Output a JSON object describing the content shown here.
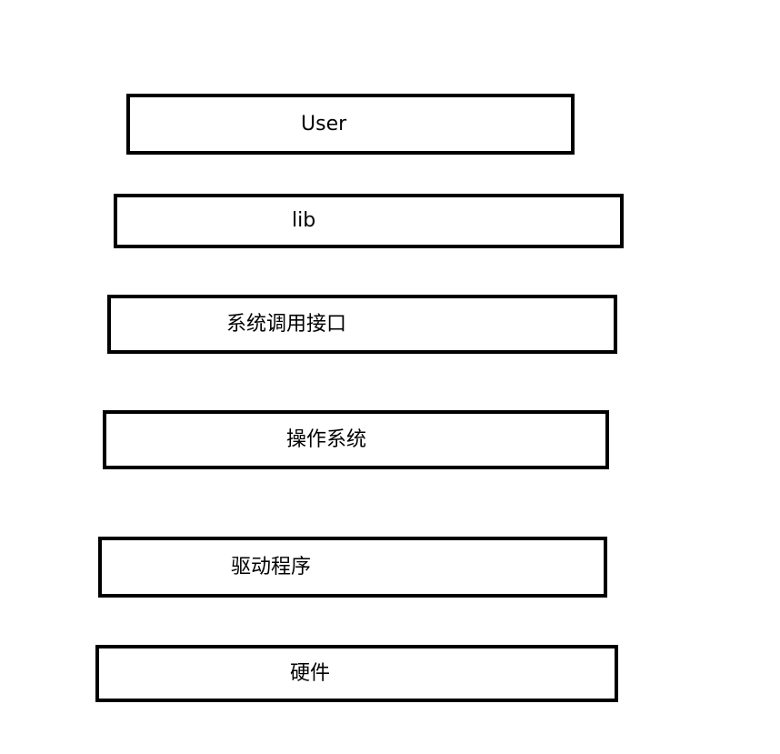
{
  "layers": [
    {
      "label": "User"
    },
    {
      "label": "lib"
    },
    {
      "label": "系统调用接口"
    },
    {
      "label": "操作系统"
    },
    {
      "label": "驱动程序"
    },
    {
      "label": "硬件"
    }
  ]
}
